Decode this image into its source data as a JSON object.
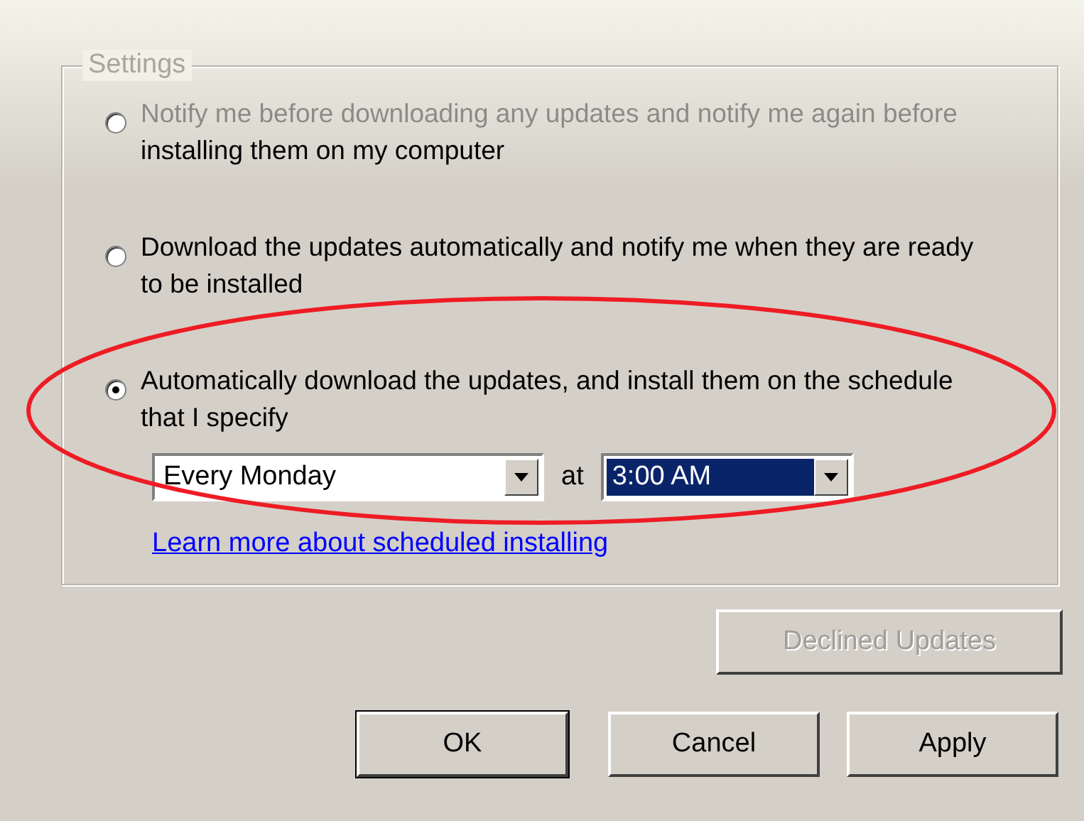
{
  "group": {
    "title": "Settings"
  },
  "options": [
    {
      "label": "Notify me before downloading any updates and notify me again before installing them on my computer",
      "selected": false,
      "faded": true
    },
    {
      "label": "Download the updates automatically and notify me when they are ready to be installed",
      "selected": false,
      "faded": false
    },
    {
      "label": "Automatically download the updates, and install them on the schedule that I specify",
      "selected": true,
      "faded": false
    }
  ],
  "schedule": {
    "day": "Every Monday",
    "at_label": "at",
    "time": "3:00 AM",
    "time_highlighted": true
  },
  "link": "Learn more about scheduled installing",
  "declined_button": {
    "label": "Declined Updates",
    "disabled": true
  },
  "buttons": [
    {
      "label": "OK",
      "default": true
    },
    {
      "label": "Cancel",
      "default": false
    },
    {
      "label": "Apply",
      "default": false
    }
  ],
  "annotation": {
    "kind": "ellipse",
    "color": "#ee1c24"
  }
}
